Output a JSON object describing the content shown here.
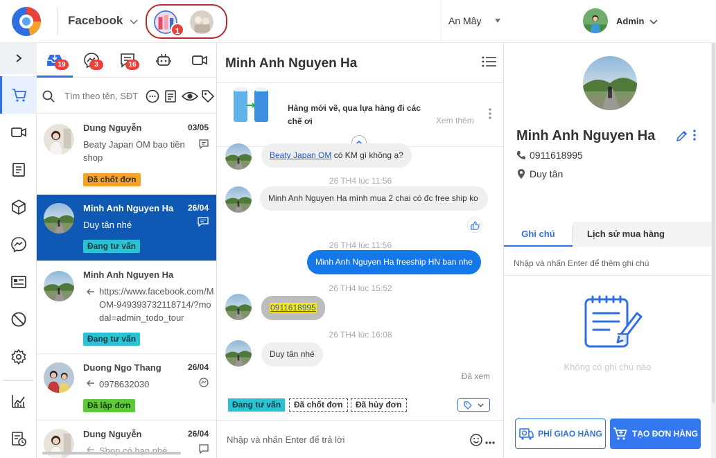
{
  "header": {
    "platform": "Facebook",
    "page_badge": "1",
    "shop": "An Mây",
    "user": "Admin",
    "colors": {
      "accent": "#2f6fe0",
      "selected_row": "#0f58b4",
      "badge": "#e8423a"
    }
  },
  "rail": {
    "items": [
      "cart-icon",
      "video-icon",
      "document-icon",
      "box-icon",
      "messenger-icon",
      "id-card-icon",
      "ban-icon",
      "gear-icon",
      "chart-icon",
      "clock-doc-icon"
    ]
  },
  "conv_tabs": [
    {
      "icon": "inbox-icon",
      "badge": "19"
    },
    {
      "icon": "messenger-icon",
      "badge": "3"
    },
    {
      "icon": "comment-icon",
      "badge": "16"
    },
    {
      "icon": "robot-icon",
      "badge": ""
    },
    {
      "icon": "video-icon",
      "badge": ""
    }
  ],
  "search": {
    "placeholder": "Tìm theo tên, SĐT"
  },
  "conversations": [
    {
      "name": "Dung Nguyễn",
      "date": "03/05",
      "message": "Beaty Japan OM bao tiền shop",
      "tag": "Đã chốt đơn"
    },
    {
      "name": "Minh Anh Nguyen Ha",
      "date": "26/04",
      "message": "Duy tân nhé",
      "tag": "Đang tư vấn"
    },
    {
      "name": "Minh Anh Nguyen Ha",
      "date": "",
      "message": "https://www.facebook.com/M OM-949393732118714/?modal=admin_todo_tour",
      "tag": "Đang tư vấn"
    },
    {
      "name": "Duong Ngo Thang",
      "date": "26/04",
      "message": "0978632030",
      "tag": "Đã lập đơn"
    },
    {
      "name": "Dung Nguyễn",
      "date": "26/04",
      "message": "Shop có hạn nhé",
      "tag": ""
    }
  ],
  "chat": {
    "title": "Minh Anh Nguyen Ha",
    "product_text": "Hàng mới về, qua lựa hàng đi các chế ơi",
    "product_more": "Xem thêm",
    "msg1_link": "Beaty Japan OM",
    "msg1_rest": " có KM gì không ạ?",
    "ts1": "26 TH4 lúc 11:56",
    "msg2": "Minh Anh Nguyen Ha mình mua 2 chai có đc free ship ko",
    "ts2": "26 TH4 lúc 11:56",
    "msg3": "Minh Anh Nguyen Ha freeship HN ban nhe",
    "ts3": "26 TH4 lúc 15:52",
    "msg4": "0911618995",
    "ts4": "26 TH4 lúc 16:08",
    "msg5": "Duy tân nhé",
    "seen": "Đã xem",
    "tags": [
      "Đang tư vấn",
      "Đã chốt đơn",
      "Đã hủy đơn"
    ],
    "input_placeholder": "Nhập và nhấn Enter để trả lời"
  },
  "customer": {
    "name": "Minh Anh Nguyen Ha",
    "phone": "0911618995",
    "address": "Duy tân",
    "tabs": [
      "Ghi chú",
      "Lịch sử mua hàng"
    ],
    "note_placeholder": "Nhập và nhấn Enter để thêm ghi chú",
    "empty_notes": "Không có ghi chú nào",
    "btn_shipping": "PHÍ GIAO HÀNG",
    "btn_order": "TẠO ĐƠN HÀNG"
  }
}
